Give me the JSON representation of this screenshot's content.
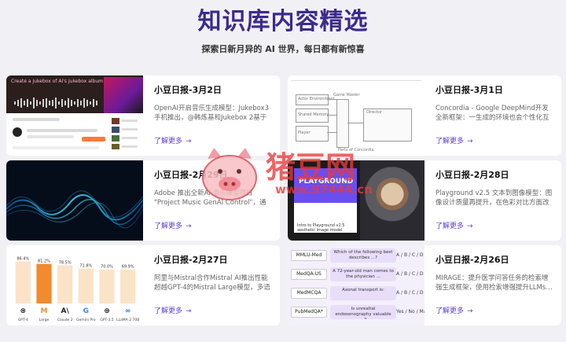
{
  "header": {
    "title": "知识库内容精选",
    "subtitle": "探索日新月异的 AI 世界，每日都有新惊喜"
  },
  "cards": [
    {
      "title": "小豆日报-3月2日",
      "desc": "OpenAI开启音乐生成模型：Jukebox3手机推出，@韩炼基和Jukebox 2基于1.2百万歌曲…",
      "more": "了解更多",
      "thumb": {
        "caption": "Create a Jukebox of AI's Jukebox album"
      }
    },
    {
      "title": "小豆日报-3月1日",
      "desc": "Concordia - Google DeepMind开发全新框架：一生成的环境也会个性化互动…",
      "more": "了解更多",
      "thumb": {
        "boxes": [
          "Actor Environment",
          "Game Master",
          "Shared Memory",
          "Player",
          "Director"
        ],
        "caption": "Parts of Concordia"
      }
    },
    {
      "title": "小豆日报-2月29日",
      "desc": "Adobe 推出全新AI 音乐模型项目 \"Project Music GenAI Control\"，通过文本提示生…",
      "more": "了解更多"
    },
    {
      "title": "小豆日报-2月28日",
      "desc": "Playground v2.5 文本到图像模型：图像设计质量再提升，在色彩对比方面改进…",
      "more": "了解更多",
      "thumb": {
        "panel_label": "PLAYGROUND",
        "panel_text": "Intro to Playground v2.5 aesthetic image model"
      }
    },
    {
      "title": "小豆日报-2月27日",
      "desc": "阿里与Mistral合作Mistral AI推出性能超越GPT-4的Mistral Large模型，多语言…",
      "more": "了解更多"
    },
    {
      "title": "小豆日报-2月26日",
      "desc": "MIRAGE：提升医学问答任务的检索增强生成框架，使用检索增强提升LLMs…",
      "more": "了解更多",
      "thumb": {
        "rows": [
          {
            "label": "MMLU-Med",
            "question": "Which of the following best describes ...?",
            "answer": "A / B / C / D"
          },
          {
            "label": "MedQA-US",
            "question": "A 72-year-old man comes to the physician ...",
            "answer": "A / B / C / D"
          },
          {
            "label": "MedMCQA",
            "question": "Axonal transport is:",
            "answer": "A / B / C / D"
          },
          {
            "label": "PubMedQA*",
            "question": "Is unrealtal endosonography valuable ...?",
            "answer": "Yes / No / Maybe"
          }
        ]
      }
    }
  ],
  "chart_data": {
    "type": "bar",
    "categories": [
      "GPT-4",
      "Large",
      "Claude 2",
      "Gemini Pro",
      "GPT-3.5",
      "LLaMA 2 70B"
    ],
    "values": [
      86.4,
      81.2,
      78.5,
      71.8,
      70.0,
      69.9
    ],
    "value_labels": [
      "86.4%",
      "81.2%",
      "78.5%",
      "71.8%",
      "70.0%",
      "69.9%"
    ],
    "icons": [
      "openai-logo",
      "mistral-logo",
      "anthropic-logo",
      "google-logo",
      "openai-logo",
      "meta-logo"
    ],
    "highlight_index": 1,
    "ylim": [
      0,
      100
    ],
    "colors": {
      "bar": "#fbe3c8",
      "highlight": "#f28a2e"
    }
  },
  "watermark": {
    "text": "猪豆网",
    "url": "www.97444.cn"
  }
}
